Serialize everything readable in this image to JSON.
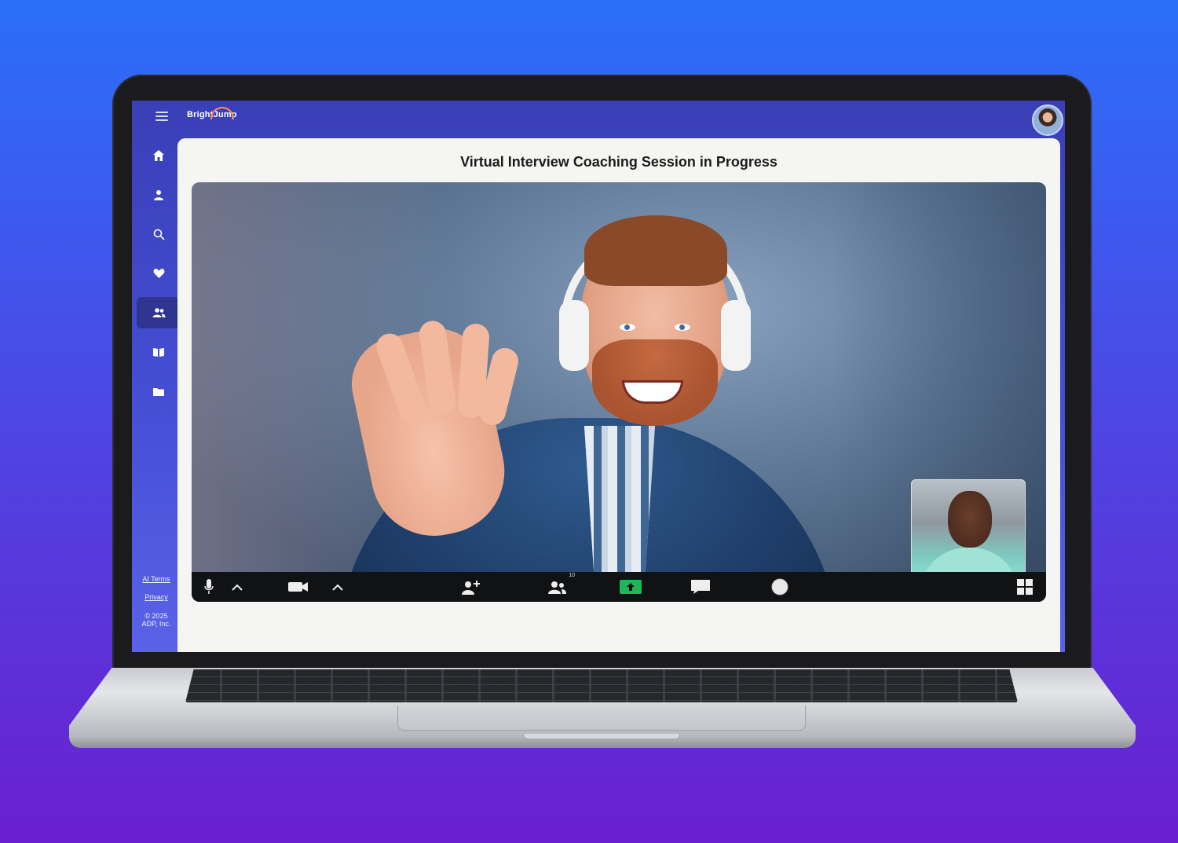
{
  "app": {
    "logo_text": "BrightJump",
    "logo_arc_color": "#ff8a5b"
  },
  "sidebar": {
    "items": [
      {
        "icon": "home-icon",
        "label": "Home",
        "active": false
      },
      {
        "icon": "user-icon",
        "label": "Profile",
        "active": false
      },
      {
        "icon": "search-icon",
        "label": "Search",
        "active": false
      },
      {
        "icon": "heart-icon",
        "label": "Favorites",
        "active": false
      },
      {
        "icon": "people-icon",
        "label": "Coaching",
        "active": true
      },
      {
        "icon": "book-icon",
        "label": "Learning",
        "active": false
      },
      {
        "icon": "folder-icon",
        "label": "Documents",
        "active": false
      }
    ],
    "footer": {
      "ai_terms": "AI Terms",
      "privacy": "Privacy",
      "copyright_line1": "© 2025",
      "copyright_line2": "ADP, Inc."
    }
  },
  "main": {
    "title": "Virtual Interview Coaching Session in Progress"
  },
  "toolbar": {
    "participants_count": "10",
    "share_color": "#1db65b"
  },
  "colors": {
    "accent": "#4650d8",
    "active_nav": "#2f3590",
    "toolbar_bg": "#111214"
  }
}
